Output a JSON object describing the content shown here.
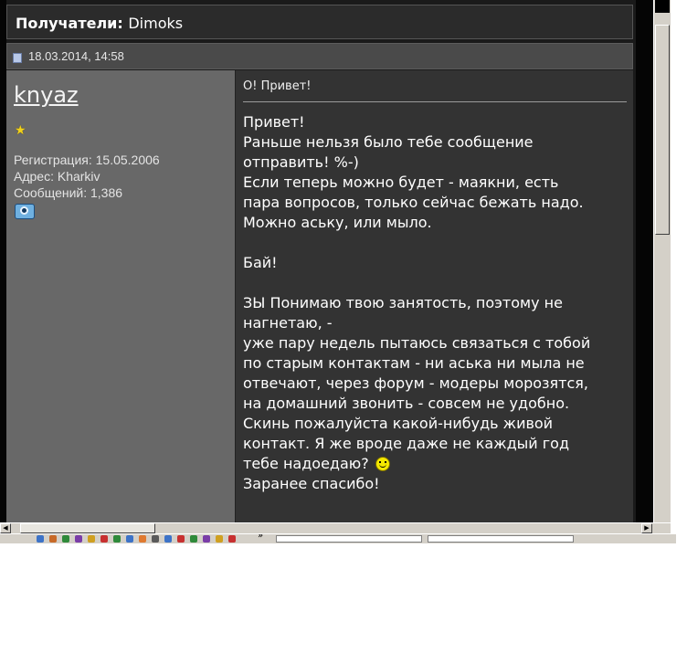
{
  "header": {
    "label": "Получатели",
    "separator": ":",
    "value": "Dimoks"
  },
  "post": {
    "date": "18.03.2014, 14:58",
    "user": {
      "name": "knyaz",
      "rank_icon": "star-icon",
      "registration": "Регистрация: 15.05.2006",
      "address": "Адрес: Kharkiv",
      "posts": "Сообщений: 1,386",
      "profile_icon": "camera-icon"
    },
    "subject": "О! Привет!",
    "lines": [
      "Привет!",
      "Раньше нельзя было тебе сообщение",
      "отправить! %-)",
      "Если теперь можно будет - маякни, есть",
      "пара вопросов, только сейчас бежать надо.",
      "Можно аську, или мыло.",
      "",
      "Бай!",
      "",
      "ЗЫ Понимаю твою занятость, поэтому не",
      "нагнетаю, -",
      "уже пару недель пытаюсь связаться с тобой",
      "по старым контактам - ни аська ни мыла не",
      "отвечают, через форум - модеры морозятся,",
      "на домашний звонить - совсем не удобно.",
      "Скинь пожалуйста какой-нибудь живой",
      "контакт. Я же вроде даже не каждый год",
      "тебе надоедаю?",
      "Заранее спасибо!"
    ],
    "smiley_icon": "smiley-icon"
  },
  "taskbar": {
    "more_glyph": "»"
  },
  "colors": {
    "page_bg": "#1a1a1a",
    "header_bg": "#2b2b2b",
    "date_bar_bg": "#4a4a4a",
    "user_panel_bg": "#686868",
    "message_panel_bg": "#333333",
    "text": "#ffffff"
  }
}
